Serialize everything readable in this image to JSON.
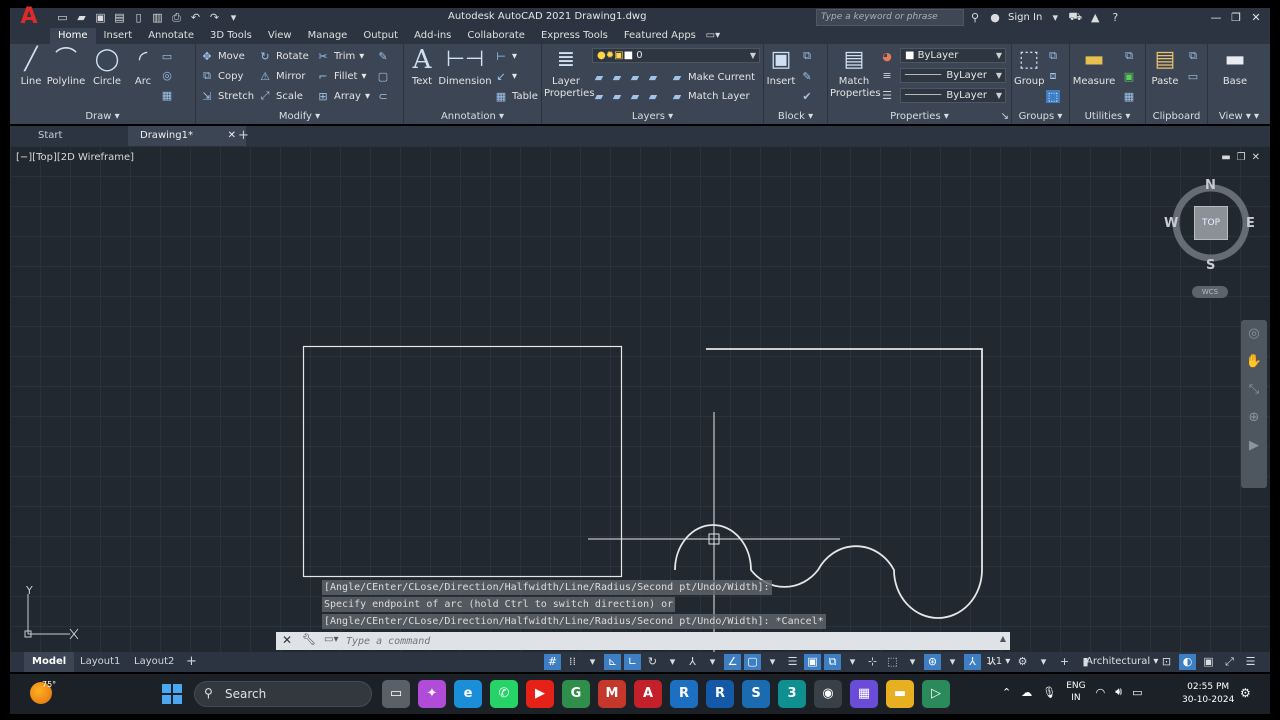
{
  "app": {
    "title": "Autodesk AutoCAD 2021    Drawing1.dwg",
    "search_placeholder": "Type a keyword or phrase",
    "sign_in": "Sign In",
    "logo": "A"
  },
  "ribbon_tabs": [
    "Home",
    "Insert",
    "Annotate",
    "3D Tools",
    "View",
    "Manage",
    "Output",
    "Add-ins",
    "Collaborate",
    "Express Tools",
    "Featured Apps"
  ],
  "panels": {
    "draw": {
      "label": "Draw",
      "line": "Line",
      "polyline": "Polyline",
      "circle": "Circle",
      "arc": "Arc"
    },
    "modify": {
      "label": "Modify",
      "move": "Move",
      "rotate": "Rotate",
      "trim": "Trim",
      "copy": "Copy",
      "mirror": "Mirror",
      "fillet": "Fillet",
      "stretch": "Stretch",
      "scale": "Scale",
      "array": "Array"
    },
    "annotation": {
      "label": "Annotation",
      "text": "Text",
      "dimension": "Dimension",
      "table": "Table"
    },
    "layers": {
      "label": "Layers",
      "layer_properties_1": "Layer",
      "layer_properties_2": "Properties",
      "layer_value": "0",
      "make_current": "Make Current",
      "match_layer": "Match Layer"
    },
    "block": {
      "label": "Block",
      "insert": "Insert"
    },
    "properties": {
      "label": "Properties",
      "match_1": "Match",
      "match_2": "Properties",
      "color": "ByLayer",
      "linetype": "ByLayer",
      "lineweight": "ByLayer"
    },
    "groups": {
      "label": "Groups",
      "group": "Group"
    },
    "utilities": {
      "label": "Utilities",
      "measure": "Measure"
    },
    "clipboard": {
      "label": "Clipboard",
      "paste": "Paste"
    },
    "view": {
      "label": "View",
      "base": "Base"
    }
  },
  "file_tabs": {
    "start": "Start",
    "drawing": "Drawing1*",
    "close": "✕",
    "add": "+"
  },
  "viewport": {
    "label": "[−][Top][2D Wireframe]",
    "viewcube": {
      "n": "N",
      "s": "S",
      "e": "E",
      "w": "W",
      "top": "TOP",
      "wcs": "WCS"
    },
    "ucs_y": "Y"
  },
  "command": {
    "history": [
      "[Angle/CEnter/CLose/Direction/Halfwidth/Line/Radius/Second pt/Undo/Width]:",
      "Specify endpoint of arc (hold Ctrl to switch direction) or",
      "[Angle/CEnter/CLose/Direction/Halfwidth/Line/Radius/Second pt/Undo/Width]: *Cancel*"
    ],
    "placeholder": "Type a command"
  },
  "layout_tabs": {
    "model": "Model",
    "layout1": "Layout1",
    "layout2": "Layout2",
    "add": "+"
  },
  "status": {
    "scale": "1:1",
    "units": "Architectural"
  },
  "taskbar": {
    "weather_temp": "75°",
    "search": "Search",
    "apps": [
      {
        "name": "file-explorer-thin",
        "glyph": "▭",
        "bg": "#5a6068"
      },
      {
        "name": "copilot",
        "glyph": "✦",
        "bg": "#b04cd8"
      },
      {
        "name": "edge",
        "glyph": "e",
        "bg": "#1a8fd8"
      },
      {
        "name": "whatsapp",
        "glyph": "✆",
        "bg": "#25d366"
      },
      {
        "name": "youtube",
        "glyph": "▶",
        "bg": "#e62117"
      },
      {
        "name": "chrome",
        "glyph": "G",
        "bg": "#2f8f4a"
      },
      {
        "name": "gmail",
        "glyph": "M",
        "bg": "#c5362b"
      },
      {
        "name": "autocad",
        "glyph": "A",
        "bg": "#c4202a"
      },
      {
        "name": "revit",
        "glyph": "R",
        "bg": "#1d6fc2"
      },
      {
        "name": "revit-2",
        "glyph": "R",
        "bg": "#1458a8"
      },
      {
        "name": "sketchup",
        "glyph": "S",
        "bg": "#1a6bb0"
      },
      {
        "name": "3dsmax",
        "glyph": "3",
        "bg": "#0f8f8f"
      },
      {
        "name": "camera",
        "glyph": "◉",
        "bg": "#3a4048"
      },
      {
        "name": "clipchamp",
        "glyph": "▦",
        "bg": "#6a4cd8"
      },
      {
        "name": "folder",
        "glyph": "▬",
        "bg": "#e8b020"
      },
      {
        "name": "media",
        "glyph": "▷",
        "bg": "#2a8a5a"
      }
    ],
    "lang_1": "ENG",
    "lang_2": "IN",
    "time": "02:55 PM",
    "date": "30-10-2024"
  },
  "colors": {
    "accent": "#3e7fc4",
    "canvas": "#212830",
    "ribbon": "#3b4553",
    "autocad_red": "#e02a2a"
  }
}
